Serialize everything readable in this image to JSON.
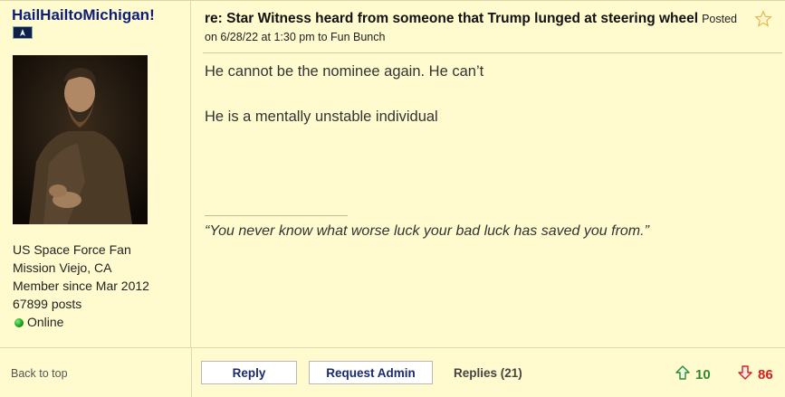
{
  "user": {
    "name": "HailHailtoMichigan!",
    "details": [
      "US Space Force Fan",
      "Mission Viejo, CA",
      "Member since Mar 2012",
      "67899 posts"
    ],
    "status": "Online"
  },
  "post": {
    "title": "re: Star Witness heard from someone that Trump lunged at steering wheel",
    "meta": "Posted on 6/28/22 at 1:30 pm to Fun Bunch",
    "body": [
      "He cannot be the nominee again. He can’t",
      "He is a mentally unstable individual"
    ],
    "signature": "“You never know what worse luck your bad luck has saved you from.”"
  },
  "footer": {
    "back_to_top": "Back to top",
    "reply_label": "Reply",
    "request_admin_label": "Request Admin",
    "replies_label": "Replies (21)",
    "upvotes": "10",
    "downvotes": "86"
  },
  "colors": {
    "background": "#fffbce",
    "username": "#0c1e7a",
    "upvote": "#2d8a2d",
    "downvote": "#d42020"
  },
  "icons": [
    "badge-icon",
    "favorite-star-icon",
    "online-status-icon",
    "upvote-arrow-icon",
    "downvote-arrow-icon"
  ]
}
